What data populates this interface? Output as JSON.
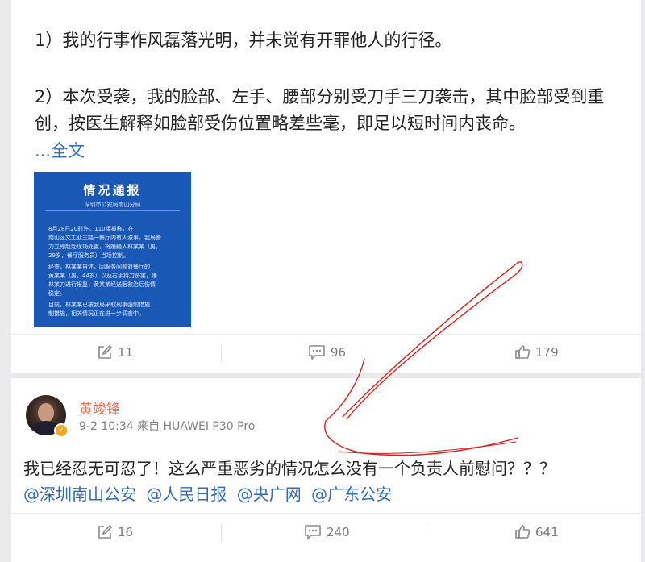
{
  "post": {
    "paragraph1": "1）我的行事作风磊落光明，并未觉有开罪他人的行径。",
    "paragraph2_line1": "2）本次受袭，我的脸部、左手、腰部分别受刀手三刀袭击，其中脸部受到重",
    "paragraph2_line2": "创，按医生解释如脸部受伤位置略差些毫，即足以短时间内丧命。",
    "more_link": "...全文",
    "image": {
      "title": "情况通报",
      "subtitle": "深圳市公安局南山分局",
      "lines": [
        "8月28日20时许，110接报称，在",
        "南山区文工业三路一餐厅内有人滋事。我局警",
        "力立即赶赴现场处置，将嫌疑人林某某（男，",
        "29岁，餐厅服务员）当场控制。",
        "经查，林某某自述，因服务问题对餐厅的",
        "黄某某（男，44岁）以及右手持刀伤害，嫌",
        "林某刀进行报复，黄某某经送医救治后伤情",
        "稳定。",
        "目前，林某某已被我局采取刑事强制措施",
        "制措施，相关情况正在进一步调查中。"
      ]
    },
    "actions": {
      "repost": "11",
      "comment": "96",
      "like": "179"
    }
  },
  "comment": {
    "user_name": "黄竣锋",
    "meta": "9-2 10:34 来自 HUAWEI P30 Pro",
    "text": "我已经忍无可忍了！这么严重恶劣的情况怎么没有一个负责人前慰问？？？",
    "mentions": [
      "@深圳南山公安",
      "@人民日报",
      "@央广网",
      "@广东公安"
    ],
    "actions": {
      "repost": "16",
      "comment": "240",
      "like": "641"
    }
  },
  "icons": {
    "repost": "edit-square-icon",
    "comment": "speech-bubble-icon",
    "like": "thumbs-up-icon",
    "verified": "verified-badge-icon"
  },
  "colors": {
    "link": "#3469b8",
    "user_name": "#eb7350",
    "annotation": "#d81e1e",
    "notice_bg": "#1a58b5"
  }
}
